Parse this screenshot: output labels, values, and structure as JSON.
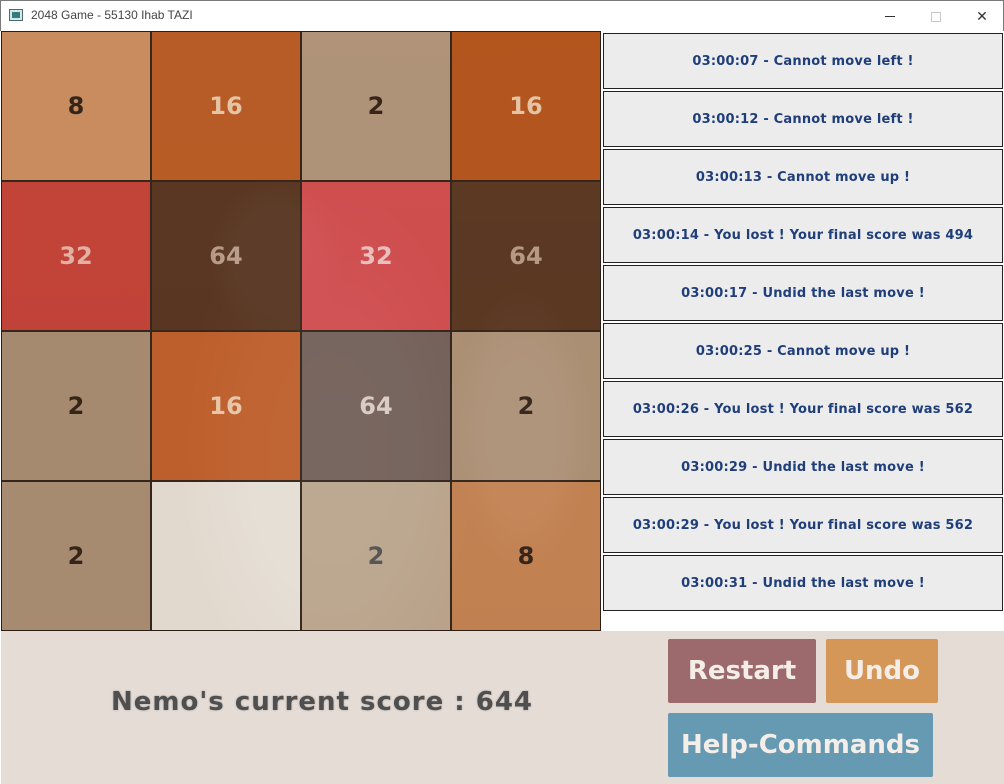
{
  "window": {
    "title": "2048 Game - 55130 Ihab TAZI",
    "controls": {
      "minimize": "",
      "maximize": "",
      "close": "✕"
    }
  },
  "board": {
    "rows": [
      [
        {
          "value": "8",
          "color": "#c98a5c",
          "text_color": "#2a1a10"
        },
        {
          "value": "16",
          "color": "#b7561f",
          "text_color": "#e8c6a8"
        },
        {
          "value": "2",
          "color": "#ae9278",
          "text_color": "#2a1a10"
        },
        {
          "value": "16",
          "color": "#b24f16",
          "text_color": "#e8c6a8"
        }
      ],
      [
        {
          "value": "32",
          "color": "#c23b32",
          "text_color": "#e6b2a8"
        },
        {
          "value": "64",
          "color": "#512e1a",
          "text_color": "#b59886"
        },
        {
          "value": "32",
          "color": "#d0474a",
          "text_color": "#ecc0c0"
        },
        {
          "value": "64",
          "color": "#53301b",
          "text_color": "#b59886"
        }
      ],
      [
        {
          "value": "2",
          "color": "#a4896f",
          "text_color": "#2a1a10"
        },
        {
          "value": "16",
          "color": "#bd5a26",
          "text_color": "#e8c6a8"
        },
        {
          "value": "64",
          "color": "#6e5b55",
          "text_color": "#d8ccc4"
        },
        {
          "value": "2",
          "color": "#aa8e73",
          "text_color": "#2a1a10"
        }
      ],
      [
        {
          "value": "2",
          "color": "#a68a71",
          "text_color": "#2a1a10"
        },
        {
          "value": "",
          "color": "#e6dfd6",
          "text_color": "#2a1a10"
        },
        {
          "value": "2",
          "color": "#b9a38b",
          "text_color": "#4a4a4a"
        },
        {
          "value": "8",
          "color": "#c27f4e",
          "text_color": "#2a1a10"
        }
      ]
    ]
  },
  "log": [
    "03:00:07 - Cannot move left !",
    "03:00:12 - Cannot move left !",
    "03:00:13 - Cannot move up !",
    "03:00:14 - You lost ! Your final score was 494",
    "03:00:17 - Undid the last move !",
    "03:00:25 - Cannot move up !",
    "03:00:26 - You lost ! Your final score was 562",
    "03:00:29 - Undid the last move !",
    "03:00:29 - You lost ! Your final score was 562",
    "03:00:31 - Undid the last move !"
  ],
  "score": {
    "text": "Nemo's current score : 644"
  },
  "buttons": {
    "restart": "Restart",
    "undo": "Undo",
    "help": "Help-Commands"
  },
  "colors": {
    "log_text": "#1f3e7a",
    "restart_bg": "#9c6a6c",
    "undo_bg": "#d49758",
    "help_bg": "#6699b2",
    "bottom_bg": "#e5dcd6"
  }
}
